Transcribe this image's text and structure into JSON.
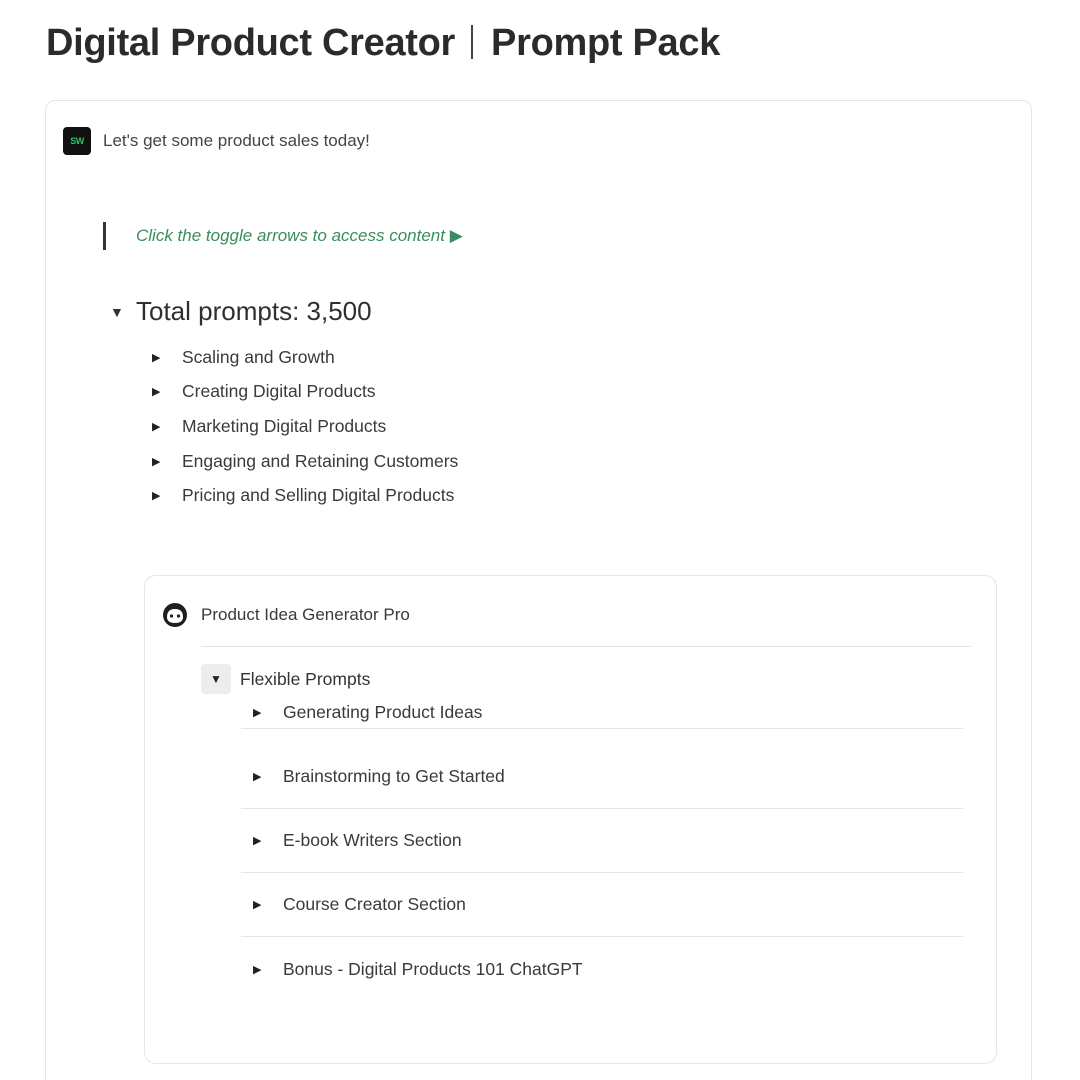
{
  "header": {
    "title_left": "Digital Product Creator",
    "title_right": "Prompt Pack"
  },
  "callout": {
    "icon": "brand-logo-icon",
    "icon_text": "SW",
    "text": "Let's get some product sales today!"
  },
  "quote": {
    "text": "Click the toggle arrows to access content ▶"
  },
  "total_toggle": {
    "title": "Total prompts: 3,500",
    "expanded": true,
    "items": [
      {
        "label": "Scaling and Growth"
      },
      {
        "label": "Creating Digital Products"
      },
      {
        "label": "Marketing Digital Products"
      },
      {
        "label": "Engaging and Retaining Customers"
      },
      {
        "label": "Pricing and Selling Digital Products"
      }
    ]
  },
  "generator": {
    "icon": "bot-avatar-icon",
    "name": "Product Idea Generator Pro",
    "section": {
      "label": "Flexible Prompts",
      "expanded": true,
      "items": [
        {
          "label": "Generating Product Ideas"
        },
        {
          "label": "Brainstorming to Get Started"
        },
        {
          "label": "E-book Writers Section"
        },
        {
          "label": "Course Creator Section"
        },
        {
          "label": "Bonus - Digital Products 101 ChatGPT"
        }
      ]
    }
  },
  "colors": {
    "accent_green": "#3a8d5c",
    "title": "#2b2b2b"
  }
}
